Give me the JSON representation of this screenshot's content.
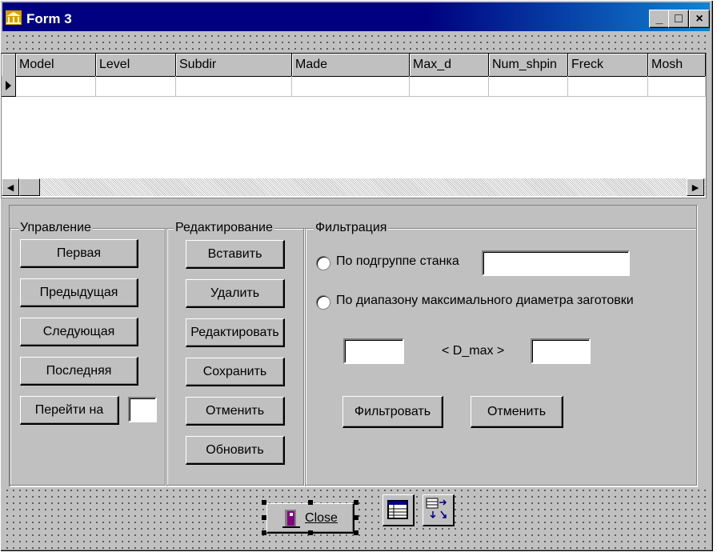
{
  "window": {
    "title": "Form 3",
    "min_label": "_",
    "max_label": "□",
    "close_label": "×"
  },
  "grid": {
    "columns": [
      "Model",
      "Level",
      "Subdir",
      "Made",
      "Max_d",
      "Num_shpin",
      "Freck",
      "Mosh"
    ],
    "scroll_left": "◀",
    "scroll_right": "▶"
  },
  "control": {
    "title": "Управление",
    "first": "Первая",
    "prev": "Предыдущая",
    "next": "Следующая",
    "last": "Последняя",
    "goto": "Перейти на",
    "goto_value": ""
  },
  "edit": {
    "title": "Редактирование",
    "insert": "Вставить",
    "delete": "Удалить",
    "edit": "Редактировать",
    "save": "Сохранить",
    "cancel": "Отменить",
    "refresh": "Обновить"
  },
  "filter": {
    "title": "Фильтрация",
    "by_subgroup": "По подгруппе станка",
    "by_range": "По диапазону максимального диаметра заготовки",
    "range_label": "< D_max >",
    "apply": "Фильтровать",
    "cancel": "Отменить",
    "subgroup_value": "",
    "min_value": "",
    "max_value": ""
  },
  "close_label": "Close",
  "colors": {
    "face": "#c0c0c0",
    "title_start": "#000080",
    "title_end": "#1084d0"
  }
}
